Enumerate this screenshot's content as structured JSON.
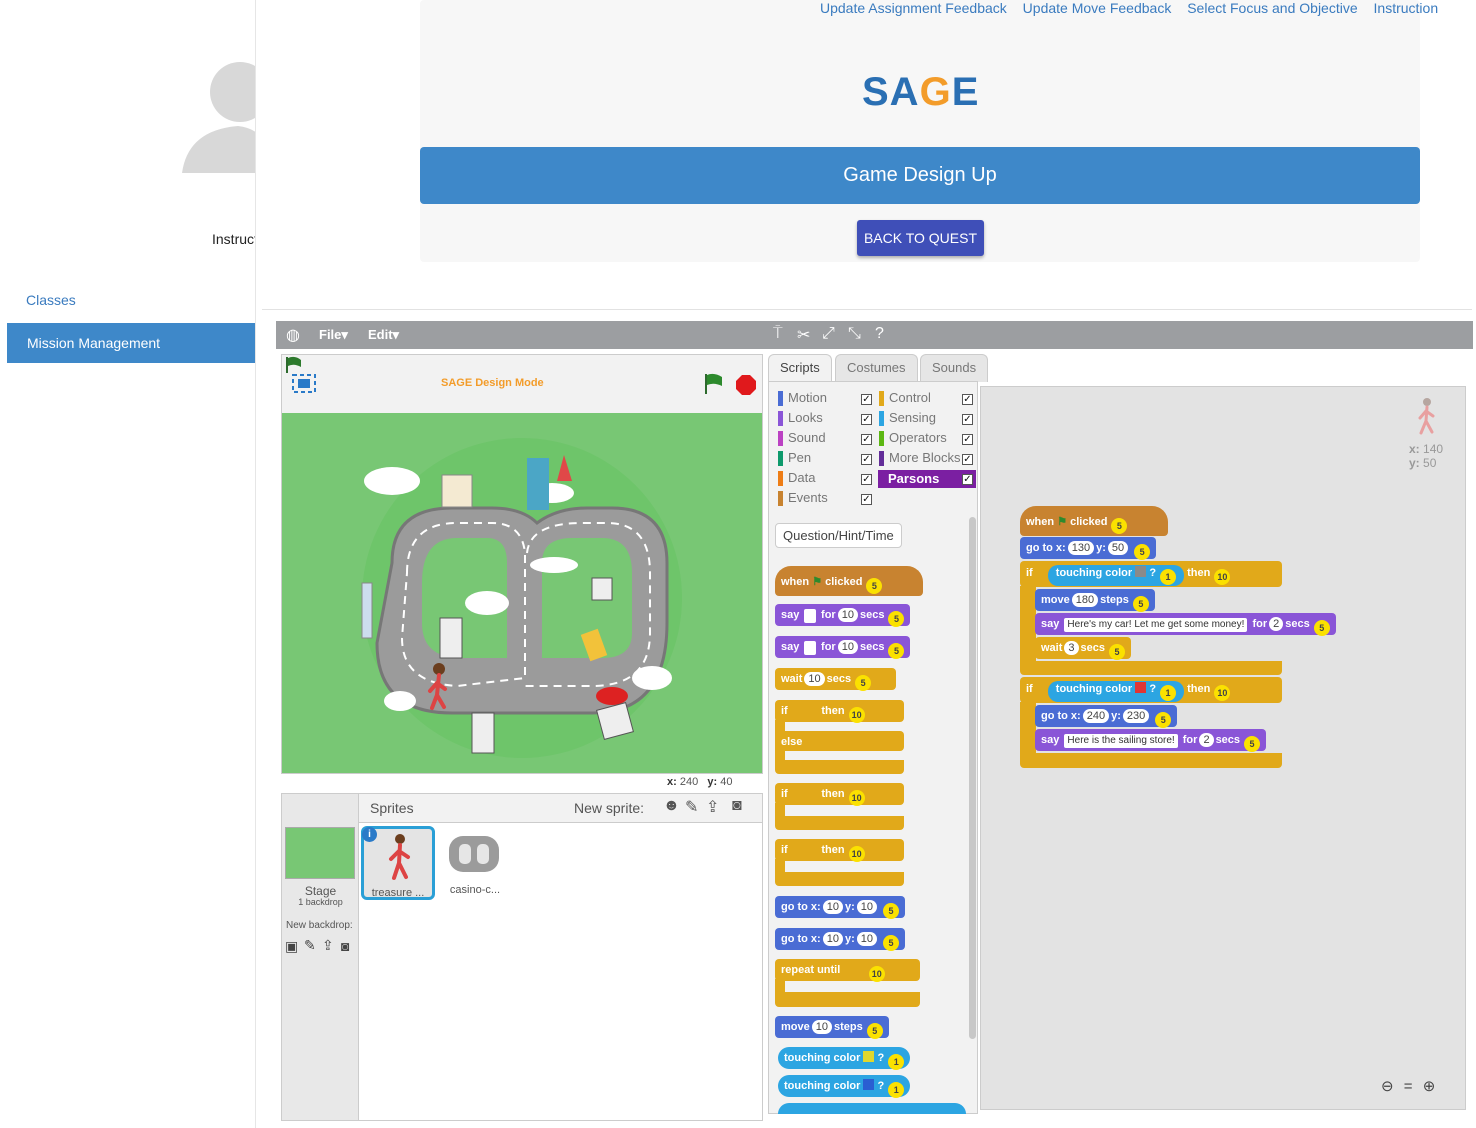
{
  "sidebar": {
    "instructor_label": "Instruct",
    "classes_link": "Classes",
    "active_item": "Mission Management"
  },
  "topnav": [
    "Update Assignment Feedback",
    "Update Move Feedback",
    "Select Focus and Objective",
    "Instruction"
  ],
  "header": {
    "logo_text_1": "SA",
    "logo_text_2": "G",
    "logo_text_3": "E",
    "banner_title": "Game Design Up",
    "back_button": "BACK TO QUEST"
  },
  "scratch": {
    "menu_file": "File▾",
    "menu_edit": "Edit▾",
    "design_mode_label": "SAGE Design Mode",
    "coords": {
      "x_label": "x:",
      "x_value": "240",
      "y_label": "y:",
      "y_value": "40"
    },
    "sprites_header": "Sprites",
    "new_sprite_label": "New sprite:",
    "stage_label": "Stage",
    "stage_backdrops": "1 backdrop",
    "new_backdrop_label": "New backdrop:",
    "sprite_tiles": [
      "treasure ...",
      "casino-c..."
    ],
    "tabs": [
      "Scripts",
      "Costumes",
      "Sounds"
    ],
    "categories_left": [
      {
        "name": "Motion",
        "color": "#4a6cd4"
      },
      {
        "name": "Looks",
        "color": "#8a55d7"
      },
      {
        "name": "Sound",
        "color": "#bb42c3"
      },
      {
        "name": "Pen",
        "color": "#0e9a6c"
      },
      {
        "name": "Data",
        "color": "#ee7d16"
      },
      {
        "name": "Events",
        "color": "#c88330"
      }
    ],
    "categories_right": [
      {
        "name": "Control",
        "color": "#e1a91a"
      },
      {
        "name": "Sensing",
        "color": "#2ca5e2"
      },
      {
        "name": "Operators",
        "color": "#5cb712"
      },
      {
        "name": "More Blocks",
        "color": "#632d99"
      }
    ],
    "parsons_label": "Parsons",
    "question_hint_button": "Question/Hint/Time",
    "palette_blocks": {
      "when": "when",
      "clicked": "clicked",
      "say": "say",
      "for": "for",
      "secs": "secs",
      "wait": "wait",
      "if": "if",
      "then": "then",
      "else": "else",
      "go_to_x": "go to x:",
      "y": "y:",
      "repeat_until": "repeat until",
      "move": "move",
      "steps": "steps",
      "touching_color": "touching color",
      "n10": "10",
      "n5": "5",
      "n1": "1",
      "q": "?"
    },
    "script_blocks": {
      "goto_x": "130",
      "goto_y": "50",
      "move_steps": "180",
      "say1_text": "Here's my car! Let me get some money!",
      "say1_secs": "2",
      "wait_secs": "3",
      "goto2_x": "240",
      "goto2_y": "230",
      "say2_text": "Here is the sailing store!",
      "say2_secs": "2"
    },
    "script_coords": {
      "x_label": "x:",
      "x": "140",
      "y_label": "y:",
      "y": "50"
    }
  }
}
